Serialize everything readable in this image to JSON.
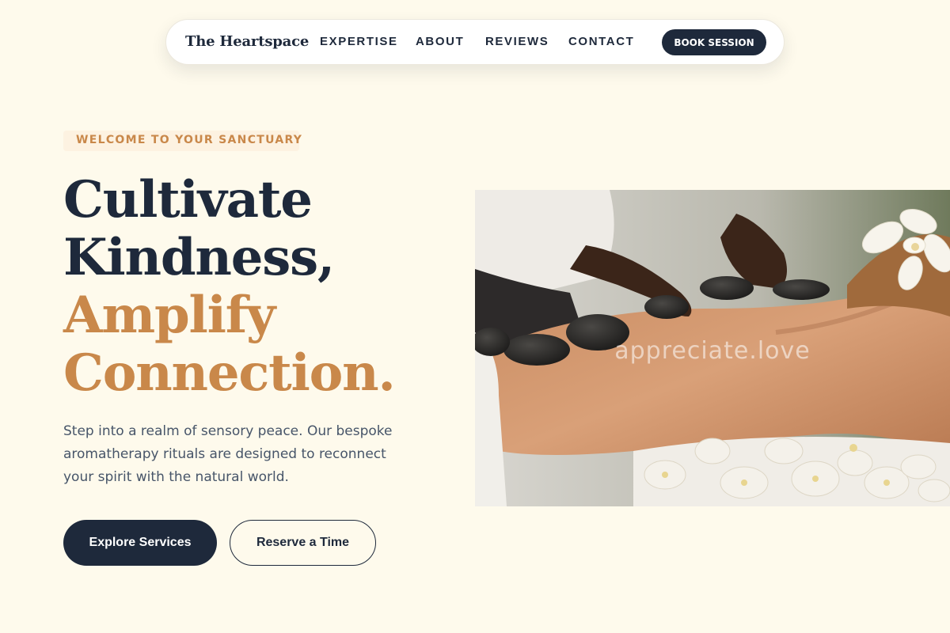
{
  "nav": {
    "brand": "The Heartspace",
    "links": [
      "EXPERTISE",
      "ABOUT",
      "REVIEWS",
      "CONTACT"
    ],
    "cta": "BOOK SESSION"
  },
  "hero": {
    "eyebrow": "WELCOME TO YOUR SANCTUARY",
    "headline": {
      "line1": "Cultivate",
      "line2": "Kindness,",
      "line3": "Amplify",
      "line4": "Connection."
    },
    "lead": "Step into a realm of sensory peace. Our bespoke aromatherapy rituals are designed to reconnect your spirit with the natural world.",
    "primary_button": "Explore Services",
    "secondary_button": "Reserve a Time"
  },
  "image": {
    "alt": "Hot stone massage with white orchids",
    "watermark": "appreciate.love"
  },
  "colors": {
    "background": "#fefaec",
    "navy": "#1e293b",
    "accent": "#c9884a",
    "eyebrow_bg": "#fdf2e1",
    "body_text": "#475569"
  }
}
